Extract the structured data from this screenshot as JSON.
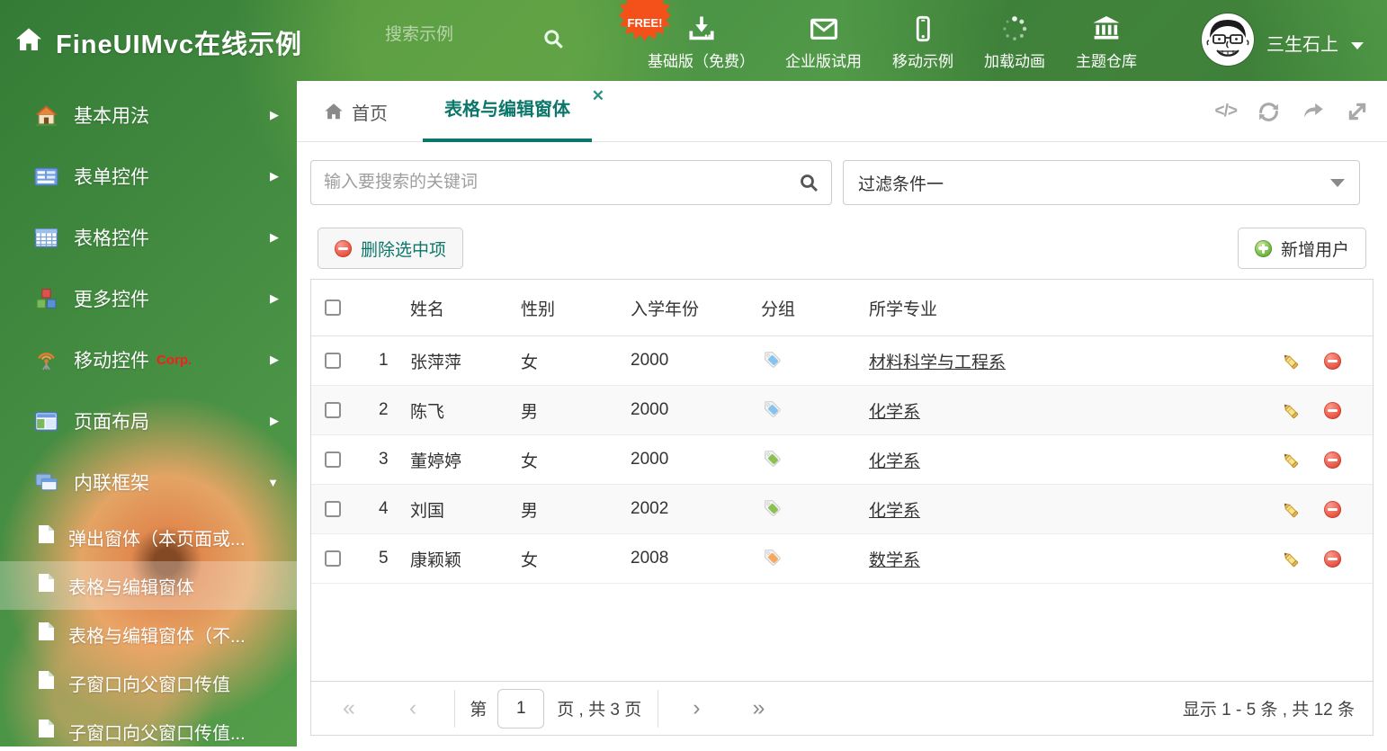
{
  "header": {
    "title": "FineUIMvc在线示例",
    "search_placeholder": "搜索示例",
    "free_badge": "FREE!",
    "nav_items": [
      {
        "icon": "download-icon",
        "label": "基础版（免费）"
      },
      {
        "icon": "envelope-icon",
        "label": "企业版试用"
      },
      {
        "icon": "phone-icon",
        "label": "移动示例"
      },
      {
        "icon": "spinner-icon",
        "label": "加载动画"
      },
      {
        "icon": "bank-icon",
        "label": "主题仓库"
      }
    ],
    "user_name": "三生石上"
  },
  "sidebar": {
    "items": [
      {
        "icon": "home-icon",
        "label": "基本用法"
      },
      {
        "icon": "form-icon",
        "label": "表单控件"
      },
      {
        "icon": "table-icon",
        "label": "表格控件"
      },
      {
        "icon": "cubes-icon",
        "label": "更多控件"
      },
      {
        "icon": "antenna-icon",
        "label": "移动控件",
        "badge": "Corp."
      },
      {
        "icon": "layout-icon",
        "label": "页面布局"
      },
      {
        "icon": "frames-icon",
        "label": "内联框架"
      }
    ],
    "subitems": [
      {
        "icon": "page-icon",
        "label": "弹出窗体（本页面或..."
      },
      {
        "icon": "page-icon",
        "label": "表格与编辑窗体",
        "active": true
      },
      {
        "icon": "page-icon",
        "label": "表格与编辑窗体（不..."
      },
      {
        "icon": "page-icon",
        "label": "子窗口向父窗口传值"
      },
      {
        "icon": "page-icon",
        "label": "子窗口向父窗口传值..."
      }
    ]
  },
  "tabs": {
    "home_label": "首页",
    "active_label": "表格与编辑窗体"
  },
  "filters": {
    "search_placeholder": "输入要搜索的关键词",
    "filter_value": "过滤条件一"
  },
  "toolbar": {
    "delete_label": "删除选中项",
    "add_label": "新增用户"
  },
  "table": {
    "columns": [
      "姓名",
      "性别",
      "入学年份",
      "分组",
      "所学专业"
    ],
    "rows": [
      {
        "num": "1",
        "name": "张萍萍",
        "gender": "女",
        "year": "2000",
        "tag_color": "blue",
        "major": "材料科学与工程系"
      },
      {
        "num": "2",
        "name": "陈飞",
        "gender": "男",
        "year": "2000",
        "tag_color": "blue",
        "major": "化学系"
      },
      {
        "num": "3",
        "name": "董婷婷",
        "gender": "女",
        "year": "2000",
        "tag_color": "green",
        "major": "化学系"
      },
      {
        "num": "4",
        "name": "刘国",
        "gender": "男",
        "year": "2002",
        "tag_color": "green",
        "major": "化学系"
      },
      {
        "num": "5",
        "name": "康颖颖",
        "gender": "女",
        "year": "2008",
        "tag_color": "orange",
        "major": "数学系"
      }
    ]
  },
  "pagination": {
    "page_prefix": "第",
    "current_page": "1",
    "page_suffix": "页 , 共 3 页",
    "summary": "显示 1 - 5 条 , 共 12 条"
  },
  "colors": {
    "accent_teal": "#0b766a",
    "badge_orange": "#f4501a",
    "tag_blue": "#85c4f0",
    "tag_green": "#8cc152",
    "tag_orange": "#f6a95c"
  }
}
